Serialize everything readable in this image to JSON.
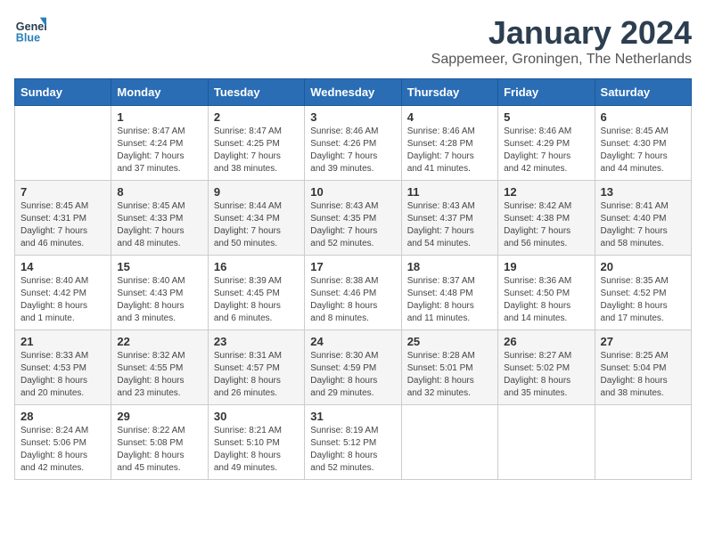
{
  "logo": {
    "line1": "General",
    "line2": "Blue"
  },
  "title": "January 2024",
  "subtitle": "Sappemeer, Groningen, The Netherlands",
  "weekdays": [
    "Sunday",
    "Monday",
    "Tuesday",
    "Wednesday",
    "Thursday",
    "Friday",
    "Saturday"
  ],
  "weeks": [
    [
      {
        "day": "",
        "info": ""
      },
      {
        "day": "1",
        "info": "Sunrise: 8:47 AM\nSunset: 4:24 PM\nDaylight: 7 hours\nand 37 minutes."
      },
      {
        "day": "2",
        "info": "Sunrise: 8:47 AM\nSunset: 4:25 PM\nDaylight: 7 hours\nand 38 minutes."
      },
      {
        "day": "3",
        "info": "Sunrise: 8:46 AM\nSunset: 4:26 PM\nDaylight: 7 hours\nand 39 minutes."
      },
      {
        "day": "4",
        "info": "Sunrise: 8:46 AM\nSunset: 4:28 PM\nDaylight: 7 hours\nand 41 minutes."
      },
      {
        "day": "5",
        "info": "Sunrise: 8:46 AM\nSunset: 4:29 PM\nDaylight: 7 hours\nand 42 minutes."
      },
      {
        "day": "6",
        "info": "Sunrise: 8:45 AM\nSunset: 4:30 PM\nDaylight: 7 hours\nand 44 minutes."
      }
    ],
    [
      {
        "day": "7",
        "info": "Sunrise: 8:45 AM\nSunset: 4:31 PM\nDaylight: 7 hours\nand 46 minutes."
      },
      {
        "day": "8",
        "info": "Sunrise: 8:45 AM\nSunset: 4:33 PM\nDaylight: 7 hours\nand 48 minutes."
      },
      {
        "day": "9",
        "info": "Sunrise: 8:44 AM\nSunset: 4:34 PM\nDaylight: 7 hours\nand 50 minutes."
      },
      {
        "day": "10",
        "info": "Sunrise: 8:43 AM\nSunset: 4:35 PM\nDaylight: 7 hours\nand 52 minutes."
      },
      {
        "day": "11",
        "info": "Sunrise: 8:43 AM\nSunset: 4:37 PM\nDaylight: 7 hours\nand 54 minutes."
      },
      {
        "day": "12",
        "info": "Sunrise: 8:42 AM\nSunset: 4:38 PM\nDaylight: 7 hours\nand 56 minutes."
      },
      {
        "day": "13",
        "info": "Sunrise: 8:41 AM\nSunset: 4:40 PM\nDaylight: 7 hours\nand 58 minutes."
      }
    ],
    [
      {
        "day": "14",
        "info": "Sunrise: 8:40 AM\nSunset: 4:42 PM\nDaylight: 8 hours\nand 1 minute."
      },
      {
        "day": "15",
        "info": "Sunrise: 8:40 AM\nSunset: 4:43 PM\nDaylight: 8 hours\nand 3 minutes."
      },
      {
        "day": "16",
        "info": "Sunrise: 8:39 AM\nSunset: 4:45 PM\nDaylight: 8 hours\nand 6 minutes."
      },
      {
        "day": "17",
        "info": "Sunrise: 8:38 AM\nSunset: 4:46 PM\nDaylight: 8 hours\nand 8 minutes."
      },
      {
        "day": "18",
        "info": "Sunrise: 8:37 AM\nSunset: 4:48 PM\nDaylight: 8 hours\nand 11 minutes."
      },
      {
        "day": "19",
        "info": "Sunrise: 8:36 AM\nSunset: 4:50 PM\nDaylight: 8 hours\nand 14 minutes."
      },
      {
        "day": "20",
        "info": "Sunrise: 8:35 AM\nSunset: 4:52 PM\nDaylight: 8 hours\nand 17 minutes."
      }
    ],
    [
      {
        "day": "21",
        "info": "Sunrise: 8:33 AM\nSunset: 4:53 PM\nDaylight: 8 hours\nand 20 minutes."
      },
      {
        "day": "22",
        "info": "Sunrise: 8:32 AM\nSunset: 4:55 PM\nDaylight: 8 hours\nand 23 minutes."
      },
      {
        "day": "23",
        "info": "Sunrise: 8:31 AM\nSunset: 4:57 PM\nDaylight: 8 hours\nand 26 minutes."
      },
      {
        "day": "24",
        "info": "Sunrise: 8:30 AM\nSunset: 4:59 PM\nDaylight: 8 hours\nand 29 minutes."
      },
      {
        "day": "25",
        "info": "Sunrise: 8:28 AM\nSunset: 5:01 PM\nDaylight: 8 hours\nand 32 minutes."
      },
      {
        "day": "26",
        "info": "Sunrise: 8:27 AM\nSunset: 5:02 PM\nDaylight: 8 hours\nand 35 minutes."
      },
      {
        "day": "27",
        "info": "Sunrise: 8:25 AM\nSunset: 5:04 PM\nDaylight: 8 hours\nand 38 minutes."
      }
    ],
    [
      {
        "day": "28",
        "info": "Sunrise: 8:24 AM\nSunset: 5:06 PM\nDaylight: 8 hours\nand 42 minutes."
      },
      {
        "day": "29",
        "info": "Sunrise: 8:22 AM\nSunset: 5:08 PM\nDaylight: 8 hours\nand 45 minutes."
      },
      {
        "day": "30",
        "info": "Sunrise: 8:21 AM\nSunset: 5:10 PM\nDaylight: 8 hours\nand 49 minutes."
      },
      {
        "day": "31",
        "info": "Sunrise: 8:19 AM\nSunset: 5:12 PM\nDaylight: 8 hours\nand 52 minutes."
      },
      {
        "day": "",
        "info": ""
      },
      {
        "day": "",
        "info": ""
      },
      {
        "day": "",
        "info": ""
      }
    ]
  ]
}
